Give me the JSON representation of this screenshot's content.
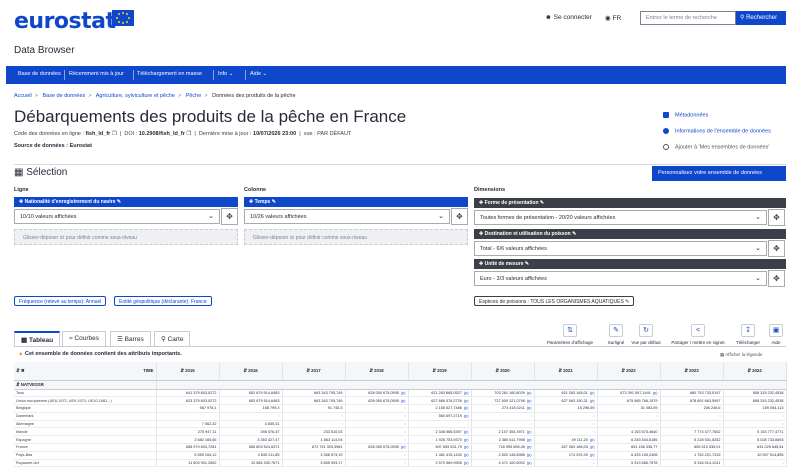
{
  "header": {
    "logo": "eurostat",
    "login": "Se connecter",
    "lang": "FR",
    "search_placeholder": "Entrez le terme de recherche",
    "search_button": "Rechercher"
  },
  "app_title": "Data Browser",
  "menu": [
    {
      "label": "Base de données"
    },
    {
      "label": "Récemment mis à jour"
    },
    {
      "label": "Téléchargement en masse"
    },
    {
      "label": "Info"
    },
    {
      "label": "Aide"
    }
  ],
  "breadcrumb": [
    "Accueil",
    "Base de données",
    "Agriculture, sylviculture et pêche",
    "Pêche",
    "Données des produits de la pêche"
  ],
  "page": {
    "title": "Débarquements des produits de la pêche en France",
    "code_label": "Code des données en ligne :",
    "code_value": "fish_ld_fr",
    "doi_label": "DOI :",
    "doi_value": "10.2908/fish_ld_fr",
    "updated_label": "Dernière mise à jour :",
    "updated_value": "10/07/2026 23:00",
    "view_label": "vue :",
    "view_value": "PAR DÉFAUT",
    "source": "Source de données : Eurostat"
  },
  "side_links": {
    "metadata": "Métadonnées",
    "dataset_info": "Informations de l'ensemble de données",
    "add_to_my": "Ajouter à 'Mes ensembles de données'"
  },
  "selection": {
    "title": "Sélection",
    "customize_button": "Personnalisez votre ensemble de données",
    "row_label": "Ligne",
    "column_label": "Colonne",
    "dimensions_label": "Dimensions",
    "row_dim": {
      "name": "Nationalité d'enregistrement du navire",
      "value": "10/10 valeurs affichées"
    },
    "col_dim": {
      "name": "Temps",
      "value": "10/26 valeurs affichées"
    },
    "drop_row": "Glisser-déposer ici pour définir comme sous-niveau",
    "drop_col": "Glisser-déposer ici pour définir comme sous-niveau",
    "dims": [
      {
        "name": "Forme de présentation",
        "value": "Toutes formes de présentation - 20/20 valeurs affichées"
      },
      {
        "name": "Destination et utilisation du poisson",
        "value": "Total - 6/6 valeurs affichées"
      },
      {
        "name": "Unité de mesure",
        "value": "Euro - 3/3 valeurs affichées"
      }
    ],
    "pill_freq": "Fréquence (relevé au temps): Annuel",
    "pill_geo": "Entité géopolitique (déclarante): France",
    "pill_species": "Espèces de poissons : TOUS LES ORGANISMES AQUATIQUES"
  },
  "tabs": [
    {
      "label": "Tableau"
    },
    {
      "label": "Courbes"
    },
    {
      "label": "Barres"
    },
    {
      "label": "Carte"
    }
  ],
  "actions": [
    {
      "label": "Paramètres d'affichage",
      "icon": "settings-icon"
    },
    {
      "label": "Surligné",
      "icon": "highlight-icon"
    },
    {
      "label": "Vue par défaut",
      "icon": "reset-icon"
    },
    {
      "label": "Partager / mettre en signet",
      "icon": "share-icon"
    },
    {
      "label": "Télécharger",
      "icon": "download-icon"
    },
    {
      "label": "Aide",
      "icon": "help-icon"
    }
  ],
  "warning": "Cet ensemble de données contient des attributs importants.",
  "legend_link": "Afficher la légende",
  "table": {
    "corner_label": "TIME",
    "group_label": "NATVESSR",
    "years": [
      "2015",
      "2016",
      "2017",
      "2018",
      "2019",
      "2020",
      "2021",
      "2022",
      "2023",
      "2024"
    ],
    "rows": [
      {
        "label": "Tous",
        "values": [
          "641 379 603,0272",
          "652 679 514,6483",
          "663 343 705,749",
          "628 050 675,0595 (p)",
          "621 263 665,0527 (p)",
          "703 261 160,8029 (p)",
          "621 263 165,01 (p)",
          "673 391 597,1441 (p)",
          "680 753 733,5197",
          "658 315 232,4538"
        ],
        "flags": [
          false,
          false,
          false,
          true,
          true,
          true,
          true,
          true,
          false,
          false
        ]
      },
      {
        "label": "Union européenne (UE6-1972, UE9-1973, UE10-1981...)",
        "values": [
          "623 379 603,0272",
          "652 679 514,6483",
          "663 343 705,749",
          "628 050 675,0595 (p)",
          "627 666 576,2726 (p)",
          "727 600 121,0796 (p)",
          "627 063 150,31 (p)",
          "675 985 766,1579",
          "678 891 663,5997",
          "658 315 232,4538"
        ],
        "flags": [
          false,
          false,
          false,
          true,
          true,
          true,
          true,
          false,
          false,
          false
        ]
      },
      {
        "label": "Belgique",
        "values": [
          "987 976,1",
          "166 799,3",
          "91 745,3",
          ":",
          "2 155 527,7486 (p)",
          "274 415,0211 (p)",
          "15 296,59",
          "31 083,59",
          "206 246,6",
          "159 054,113"
        ],
        "flags": [
          false,
          false,
          false,
          false,
          true,
          true,
          false,
          false,
          false,
          false
        ]
      },
      {
        "label": "Danemark",
        "values": [
          ":",
          ":",
          ":",
          ":",
          "560 697,2719 (p)",
          ":",
          ":",
          ":",
          ":",
          ":"
        ],
        "flags": [
          false,
          false,
          false,
          false,
          true,
          false,
          false,
          false,
          false,
          false
        ]
      },
      {
        "label": "Allemagne",
        "values": [
          "7 062,32",
          "4 835,31",
          ":",
          ":",
          ":",
          ":",
          ":",
          ":",
          ":",
          ":"
        ],
        "flags": [
          false,
          false,
          false,
          false,
          false,
          false,
          false,
          false,
          false,
          false
        ]
      },
      {
        "label": "Irlande",
        "values": [
          "275 947,11",
          "395 576,37",
          "233 510,03",
          ":",
          "2 346 565,5397 (p)",
          "2 107 454,3971 (p)",
          ":",
          "4 153 575,4640",
          "7 774 477,7652",
          "5 153 777,4771"
        ],
        "flags": [
          false,
          false,
          false,
          false,
          true,
          true,
          false,
          false,
          false,
          false
        ]
      },
      {
        "label": "Espagne",
        "values": [
          "2 682 165,66",
          "3 353 427,47",
          "1 663 114,04",
          ":",
          "1 926 753,9370 (p)",
          "2 380 511,7998 (p)",
          "49 111,20 (p)",
          "6 283 534,6185",
          "5 228 531,5252",
          "5 028 733,6693"
        ],
        "flags": [
          false,
          false,
          false,
          false,
          true,
          true,
          true,
          false,
          false,
          false
        ]
      },
      {
        "label": "France",
        "values": [
          "658 979 603,7281",
          "656 803 524,6371",
          "672 791 303,3981",
          "628 050 675,0595 (p)",
          "697 659 531,79 (p)",
          "718 955 655,45 (p)",
          "627 063 186,03 (p)",
          "651 156 336,77",
          "655 513 535,01",
          "631 025 645,54"
        ],
        "flags": [
          false,
          false,
          false,
          true,
          true,
          true,
          true,
          false,
          false,
          false
        ]
      },
      {
        "label": "Pays-Bas",
        "values": [
          "5 559 154,12",
          "4 635 211,85",
          "3 356 573,19",
          ":",
          "1 481 415,1432 (p)",
          "2 620 145,6985 (p)",
          "174 291,00 (p)",
          "6 425 105,2406",
          "1 752 221,7315",
          "10 957 514,855"
        ],
        "flags": [
          false,
          false,
          false,
          false,
          true,
          true,
          true,
          false,
          false,
          false
        ]
      },
      {
        "label": "Royaume-Uni",
        "values": [
          "11 603 901,2652",
          "10 584 330,7671",
          "3 655 993,17",
          ":",
          "2 570 569,9905 (p)",
          "4 471 100,6002 (p)",
          ":",
          "5 913 586,7578",
          "5 316 014,1241",
          ":"
        ],
        "flags": [
          false,
          false,
          false,
          false,
          true,
          true,
          false,
          false,
          false,
          false
        ]
      }
    ]
  }
}
